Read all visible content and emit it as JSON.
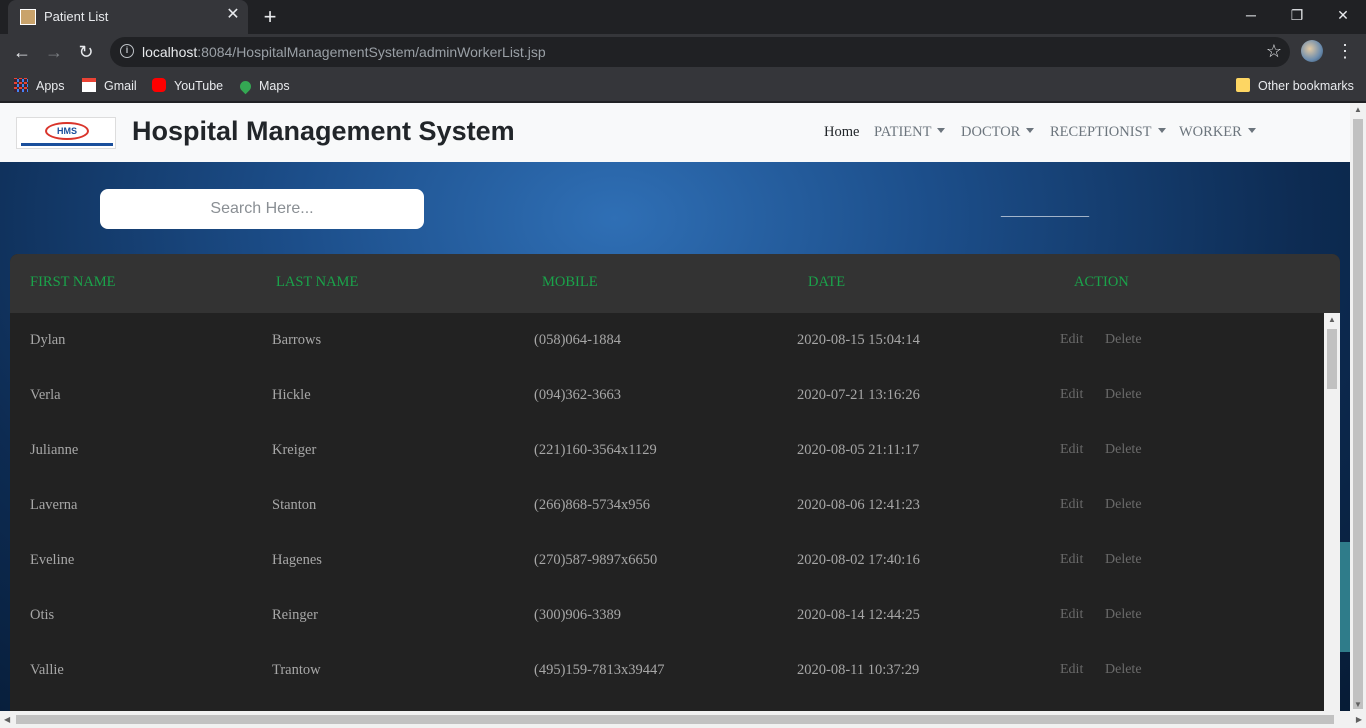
{
  "browser": {
    "tab_title": "Patient List",
    "url_host": "localhost",
    "url_rest": ":8084/HospitalManagementSystem/adminWorkerList.jsp",
    "bookmarks": [
      "Apps",
      "Gmail",
      "YouTube",
      "Maps"
    ],
    "other_bookmarks": "Other bookmarks"
  },
  "navbar": {
    "logo_text": "HMS",
    "brand": "Hospital Management System",
    "links": [
      {
        "label": "Home",
        "dropdown": false,
        "active": true
      },
      {
        "label": "PATIENT",
        "dropdown": true,
        "active": false
      },
      {
        "label": "DOCTOR",
        "dropdown": true,
        "active": false
      },
      {
        "label": "RECEPTIONIST",
        "dropdown": true,
        "active": false
      },
      {
        "label": "WORKER",
        "dropdown": true,
        "active": false
      }
    ]
  },
  "search": {
    "placeholder": "Search Here..."
  },
  "table": {
    "headers": [
      "FIRST NAME",
      "LAST NAME",
      "MOBILE",
      "DATE",
      "ACTION"
    ],
    "edit_label": "Edit",
    "delete_label": "Delete",
    "rows": [
      {
        "first": "Dylan",
        "last": "Barrows",
        "mobile": "(058)064-1884",
        "date": "2020-08-15 15:04:14"
      },
      {
        "first": "Verla",
        "last": "Hickle",
        "mobile": "(094)362-3663",
        "date": "2020-07-21 13:16:26"
      },
      {
        "first": "Julianne",
        "last": "Kreiger",
        "mobile": "(221)160-3564x1129",
        "date": "2020-08-05 21:11:17"
      },
      {
        "first": "Laverna",
        "last": "Stanton",
        "mobile": "(266)868-5734x956",
        "date": "2020-08-06 12:41:23"
      },
      {
        "first": "Eveline",
        "last": "Hagenes",
        "mobile": "(270)587-9897x6650",
        "date": "2020-08-02 17:40:16"
      },
      {
        "first": "Otis",
        "last": "Reinger",
        "mobile": "(300)906-3389",
        "date": "2020-08-14 12:44:25"
      },
      {
        "first": "Vallie",
        "last": "Trantow",
        "mobile": "(495)159-7813x39447",
        "date": "2020-08-11 10:37:29"
      }
    ]
  },
  "colors": {
    "header_text": "#1aa34a",
    "table_bg": "#222222",
    "thead_bg": "#333333",
    "navbar_bg": "#f8f9fa"
  }
}
